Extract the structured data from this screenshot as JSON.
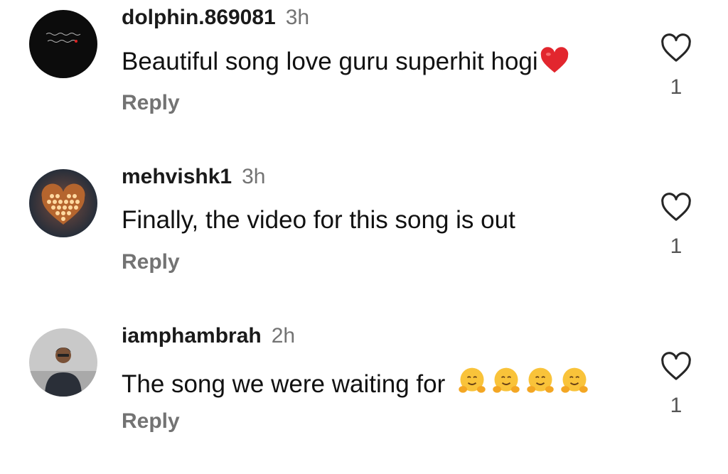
{
  "comments": [
    {
      "username": "dolphin.869081",
      "time": "3h",
      "text": "Beautiful song love guru superhit hogi",
      "emoji": "red-heart",
      "reply": "Reply",
      "likes": "1"
    },
    {
      "username": "mehvishk1",
      "time": "3h",
      "text": "Finally, the video for this song is out",
      "reply": "Reply",
      "likes": "1"
    },
    {
      "username": "iamphambrah",
      "time": "2h",
      "text": "The song we were waiting for ",
      "emoji": "hugging-face",
      "emoji_count": 4,
      "reply": "Reply",
      "likes": "1"
    }
  ],
  "colors": {
    "secondary_text": "#737373",
    "heart_emoji": "#e2262e",
    "hug_emoji": "#f9c33a"
  }
}
